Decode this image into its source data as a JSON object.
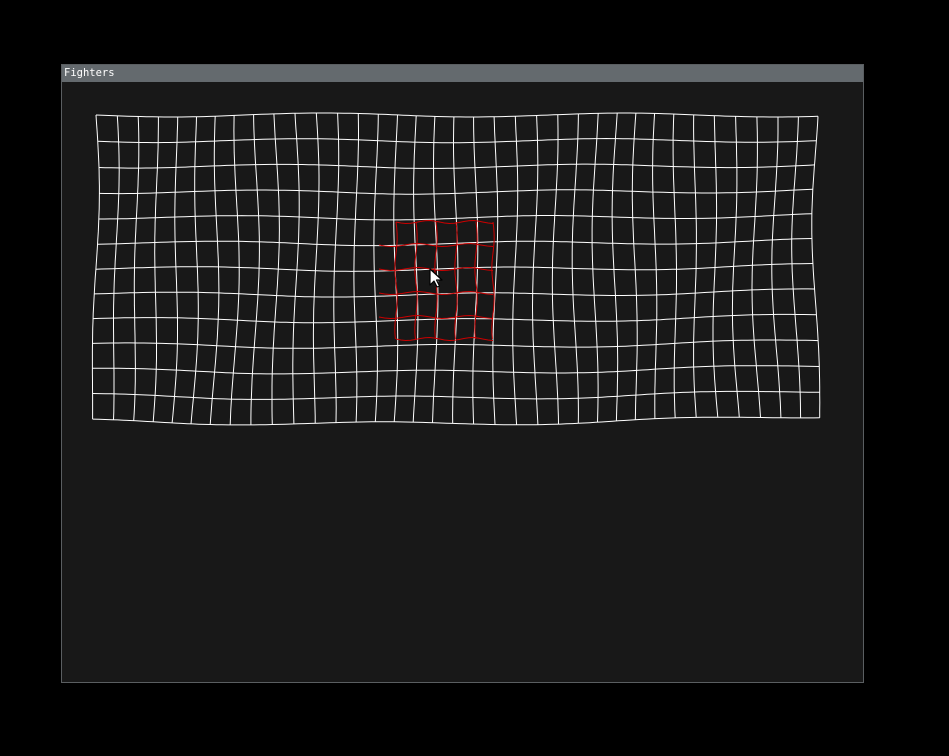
{
  "window": {
    "title": "Fighters"
  },
  "mesh": {
    "columns": 36,
    "rows": 12,
    "line_color": "#ffffff",
    "highlight_color": "#cc0000"
  },
  "cursor": {
    "icon": "pointer-cursor-icon"
  }
}
